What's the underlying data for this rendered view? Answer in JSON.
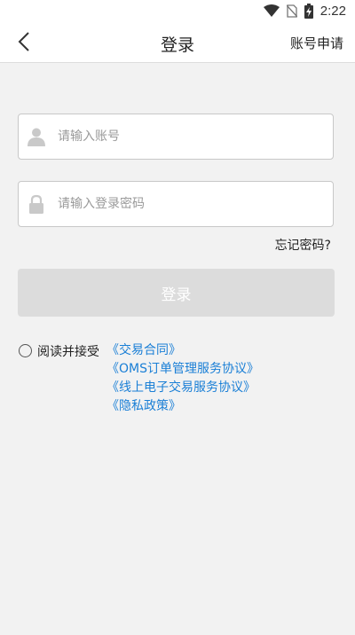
{
  "status_bar": {
    "time": "2:22",
    "icons": [
      "wifi-icon",
      "no-sim-icon",
      "battery-charging-icon"
    ]
  },
  "header": {
    "back_icon": "chevron-left-icon",
    "title": "登录",
    "action_label": "账号申请"
  },
  "form": {
    "account": {
      "icon": "user-icon",
      "placeholder": "请输入账号",
      "value": ""
    },
    "password": {
      "icon": "lock-icon",
      "placeholder": "请输入登录密码",
      "value": ""
    },
    "forgot_label": "忘记密码?",
    "login_label": "登录"
  },
  "agreement": {
    "checked": false,
    "prefix": "阅读并接受",
    "links": [
      "《交易合同》",
      "《OMS订单管理服务协议》",
      "《线上电子交易服务协议》",
      "《隐私政策》"
    ]
  },
  "colors": {
    "link": "#1a7fd6",
    "button_disabled": "#dcdcdc",
    "background": "#f2f2f2"
  }
}
